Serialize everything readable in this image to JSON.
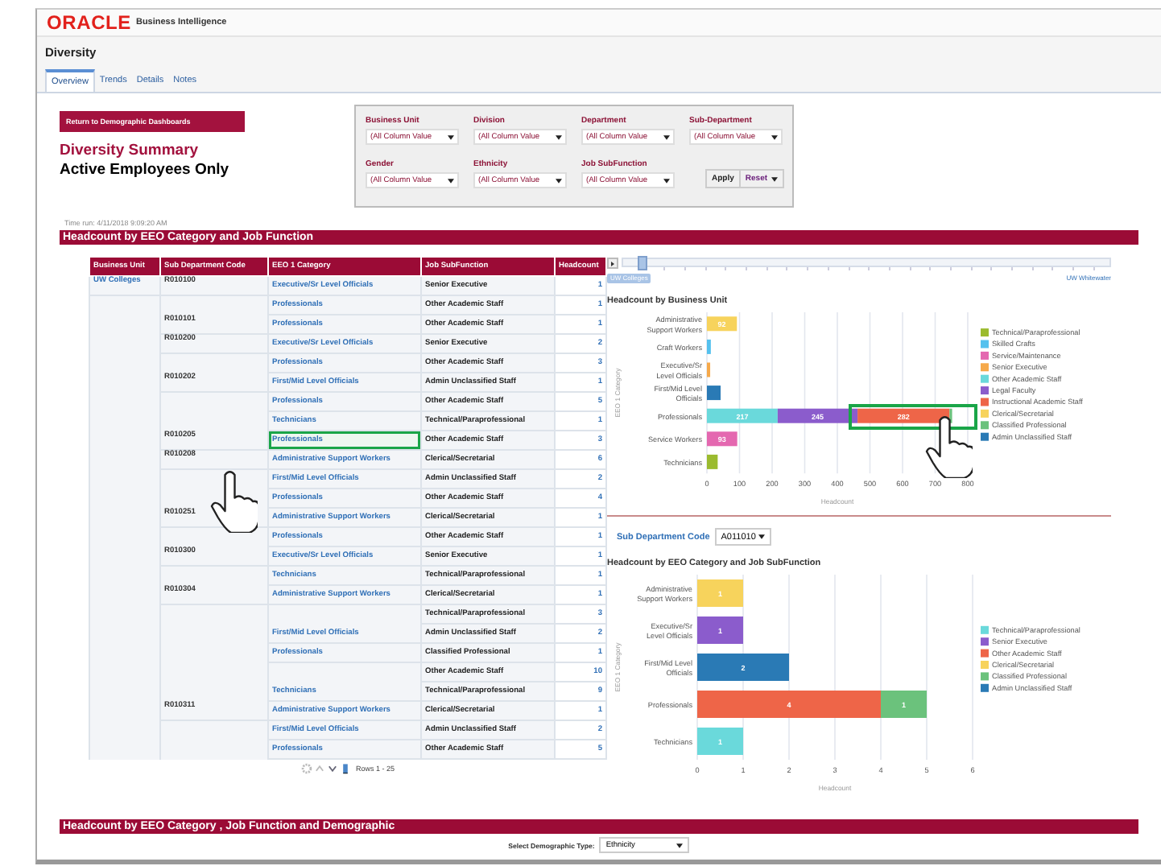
{
  "brand": {
    "logo": "ORACLE",
    "product": "Business Intelligence"
  },
  "page_title": "Diversity",
  "tabs": [
    {
      "label": "Overview",
      "selected": true
    },
    {
      "label": "Trends",
      "selected": false
    },
    {
      "label": "Details",
      "selected": false
    },
    {
      "label": "Notes",
      "selected": false
    }
  ],
  "return_button": "Return to Demographic Dashboards",
  "summary_title": "Diversity Summary",
  "summary_subtitle": "Active Employees Only",
  "filter_rows": [
    [
      {
        "label": "Business Unit",
        "value": "(All Column Value"
      },
      {
        "label": "Division",
        "value": "(All Column Value"
      },
      {
        "label": "Department",
        "value": "(All Column Value"
      },
      {
        "label": "Sub-Department",
        "value": "(All Column Value"
      }
    ],
    [
      {
        "label": "Gender",
        "value": "(All Column Value"
      },
      {
        "label": "Ethnicity",
        "value": "(All Column Value"
      },
      {
        "label": "Job SubFunction",
        "value": "(All Column Value"
      }
    ]
  ],
  "apply_button": "Apply",
  "reset_button": "Reset",
  "time_run": "Time run: 4/11/2018 9:09:20 AM",
  "section_1": "Headcount by EEO Category and Job Function",
  "table": {
    "columns": [
      "Business Unit",
      "Sub Department Code",
      "EEO 1 Category",
      "Job SubFunction",
      "Headcount"
    ],
    "rows": [
      {
        "business_unit": "UW Colleges",
        "sub_department_code": "R010100",
        "eeo_category": "Executive/Sr Level Officials",
        "job_subfunction": "Senior Executive",
        "headcount": "1",
        "highlighted": false
      },
      {
        "eeo_category": "Professionals",
        "job_subfunction": "Other Academic Staff",
        "headcount": "1",
        "highlighted": false
      },
      {
        "sub_department_code": "R010101",
        "eeo_category": "Professionals",
        "job_subfunction": "Other Academic Staff",
        "headcount": "1",
        "highlighted": false
      },
      {
        "sub_department_code": "R010200",
        "eeo_category": "Executive/Sr Level Officials",
        "job_subfunction": "Senior Executive",
        "headcount": "2",
        "highlighted": false
      },
      {
        "eeo_category": "Professionals",
        "job_subfunction": "Other Academic Staff",
        "headcount": "3",
        "highlighted": false
      },
      {
        "sub_department_code": "R010202",
        "eeo_category": "First/Mid Level Officials",
        "job_subfunction": "Admin Unclassified Staff",
        "headcount": "1",
        "highlighted": false
      },
      {
        "eeo_category": "Professionals",
        "job_subfunction": "Other Academic Staff",
        "headcount": "5",
        "highlighted": false
      },
      {
        "eeo_category": "Technicians",
        "job_subfunction": "Technical/Paraprofessional",
        "headcount": "1",
        "highlighted": false
      },
      {
        "sub_department_code": "R010205",
        "eeo_category": "Professionals",
        "job_subfunction": "Other Academic Staff",
        "headcount": "3",
        "highlighted": true
      },
      {
        "sub_department_code": "R010208",
        "eeo_category": "Administrative Support Workers",
        "job_subfunction": "Clerical/Secretarial",
        "headcount": "6",
        "highlighted": false
      },
      {
        "eeo_category": "First/Mid Level Officials",
        "job_subfunction": "Admin Unclassified Staff",
        "headcount": "2",
        "highlighted": false
      },
      {
        "eeo_category": "Professionals",
        "job_subfunction": "Other Academic Staff",
        "headcount": "4",
        "highlighted": false
      },
      {
        "sub_department_code": "R010251",
        "eeo_category": "Administrative Support Workers",
        "job_subfunction": "Clerical/Secretarial",
        "headcount": "1",
        "highlighted": false
      },
      {
        "eeo_category": "Professionals",
        "job_subfunction": "Other Academic Staff",
        "headcount": "1",
        "highlighted": false
      },
      {
        "sub_department_code": "R010300",
        "eeo_category": "Executive/Sr Level Officials",
        "job_subfunction": "Senior Executive",
        "headcount": "1",
        "highlighted": false
      },
      {
        "eeo_category": "Technicians",
        "job_subfunction": "Technical/Paraprofessional",
        "headcount": "1",
        "highlighted": false
      },
      {
        "sub_department_code": "R010304",
        "eeo_category": "Administrative Support Workers",
        "job_subfunction": "Clerical/Secretarial",
        "headcount": "1",
        "highlighted": false
      },
      {
        "job_subfunction": "Technical/Paraprofessional",
        "headcount": "3",
        "highlighted": false
      },
      {
        "eeo_category": "First/Mid Level Officials",
        "job_subfunction": "Admin Unclassified Staff",
        "headcount": "2",
        "highlighted": false
      },
      {
        "eeo_category": "Professionals",
        "job_subfunction": "Classified Professional",
        "headcount": "1",
        "highlighted": false
      },
      {
        "job_subfunction": "Other Academic Staff",
        "headcount": "10",
        "highlighted": false
      },
      {
        "eeo_category": "Technicians",
        "job_subfunction": "Technical/Paraprofessional",
        "headcount": "9",
        "highlighted": false
      },
      {
        "sub_department_code": "R010311",
        "eeo_category": "Administrative Support Workers",
        "job_subfunction": "Clerical/Secretarial",
        "headcount": "1",
        "highlighted": false
      },
      {
        "eeo_category": "First/Mid Level Officials",
        "job_subfunction": "Admin Unclassified Staff",
        "headcount": "2",
        "highlighted": false
      },
      {
        "eeo_category": "Professionals",
        "job_subfunction": "Other Academic Staff",
        "headcount": "5",
        "highlighted": false
      }
    ],
    "pager": "Rows 1 - 25"
  },
  "right_panel": {
    "slider": {
      "level": 0.03,
      "start_label": "UW Colleges",
      "end_label": "UW Whitewater"
    },
    "sections": [
      {
        "chart_data": {
          "type": "bar",
          "orientation": "horizontal",
          "stacked": true,
          "title": "Headcount by Business Unit",
          "xlabel": "Headcount",
          "ylabel": "EEO 1 Category",
          "grid": true,
          "legend": "right",
          "categories": [
            "Administrative Support Workers",
            "Craft Workers",
            "Executive/Sr Level Officials",
            "First/Mid Level Officials",
            "Professionals",
            "Service Workers",
            "Technicians"
          ],
          "xlim": [
            0,
            800
          ],
          "xticks": [
            0,
            100,
            200,
            300,
            400,
            500,
            600,
            700,
            800
          ],
          "series": [
            {
              "name": "Technical/Paraprofessional",
              "color": "#9bbb2f",
              "values": [
                null,
                null,
                null,
                null,
                null,
                null,
                33
              ],
              "value_labels": [
                null,
                null,
                null,
                null,
                null,
                null,
                null
              ]
            },
            {
              "name": "Skilled Crafts",
              "color": "#55c1ee",
              "values": [
                null,
                12,
                null,
                null,
                null,
                null,
                null
              ],
              "value_labels": [
                null,
                null,
                null,
                null,
                null,
                null,
                null
              ]
            },
            {
              "name": "Service/Maintenance",
              "color": "#e468b0",
              "values": [
                null,
                null,
                null,
                null,
                null,
                93,
                null
              ],
              "value_labels": [
                null,
                null,
                null,
                null,
                null,
                "93",
                null
              ]
            },
            {
              "name": "Senior Executive",
              "color": "#f6a94a",
              "values": [
                null,
                null,
                10,
                null,
                null,
                null,
                null
              ],
              "value_labels": [
                null,
                null,
                null,
                null,
                null,
                null,
                null
              ]
            },
            {
              "name": "Other Academic Staff",
              "color": "#6ad9db",
              "values": [
                null,
                null,
                null,
                null,
                217,
                null,
                null
              ],
              "value_labels": [
                null,
                null,
                null,
                null,
                "217",
                null,
                null
              ]
            },
            {
              "name": "Legal Faculty",
              "color": "#8b5ccc",
              "values": [
                null,
                null,
                null,
                null,
                245,
                null,
                null
              ],
              "value_labels": [
                null,
                null,
                null,
                null,
                "245",
                null,
                null
              ]
            },
            {
              "name": "Instructional Academic Staff",
              "color": "#ee6548",
              "values": [
                null,
                null,
                null,
                null,
                282,
                null,
                null
              ],
              "value_labels": [
                null,
                null,
                null,
                null,
                "282",
                null,
                null
              ]
            },
            {
              "name": "Clerical/Secretarial",
              "color": "#f7d35c",
              "values": [
                92,
                null,
                null,
                null,
                null,
                null,
                null
              ],
              "value_labels": [
                "92",
                null,
                null,
                null,
                null,
                null,
                null
              ]
            },
            {
              "name": "Classified Professional",
              "color": "#6bc27c",
              "values": [
                null,
                null,
                null,
                null,
                8,
                null,
                null
              ],
              "value_labels": [
                null,
                null,
                null,
                null,
                null,
                null,
                null
              ]
            },
            {
              "name": "Admin Unclassified Staff",
              "color": "#2a7ab5",
              "values": [
                null,
                null,
                null,
                42,
                null,
                null,
                null
              ],
              "value_labels": [
                null,
                null,
                null,
                null,
                null,
                null,
                null
              ]
            }
          ]
        }
      },
      {
        "filter": {
          "label": "Sub Department Code",
          "value": "A011010"
        },
        "chart_data": {
          "type": "bar",
          "orientation": "horizontal",
          "stacked": true,
          "title": "Headcount by EEO Category and Job SubFunction",
          "xlabel": "Headcount",
          "ylabel": "EEO 1 Category",
          "data_labels": true,
          "grid": true,
          "legend": "right",
          "categories": [
            "Administrative Support Workers",
            "Executive/Sr Level Officials",
            "First/Mid Level Officials",
            "Professionals",
            "Technicians"
          ],
          "xlim": [
            0,
            6
          ],
          "xticks": [
            0,
            1,
            2,
            3,
            4,
            5,
            6
          ],
          "series": [
            {
              "name": "Technical/Paraprofessional",
              "color": "#6ad9db",
              "values": [
                null,
                null,
                null,
                null,
                1
              ]
            },
            {
              "name": "Senior Executive",
              "color": "#8b5ccc",
              "values": [
                null,
                1,
                null,
                null,
                null
              ]
            },
            {
              "name": "Other Academic Staff",
              "color": "#ee6548",
              "values": [
                null,
                null,
                null,
                4,
                null
              ]
            },
            {
              "name": "Clerical/Secretarial",
              "color": "#f7d35c",
              "values": [
                1,
                null,
                null,
                null,
                null
              ]
            },
            {
              "name": "Classified Professional",
              "color": "#6bc27c",
              "values": [
                null,
                null,
                null,
                1,
                null
              ]
            },
            {
              "name": "Admin Unclassified Staff",
              "color": "#2a7ab5",
              "values": [
                null,
                null,
                2,
                null,
                null
              ]
            }
          ]
        }
      }
    ]
  },
  "section_2": "Headcount by EEO Category , Job Function and Demographic",
  "demographic_select": {
    "label": "Select Demographic Type:",
    "value": "Ethnicity"
  }
}
